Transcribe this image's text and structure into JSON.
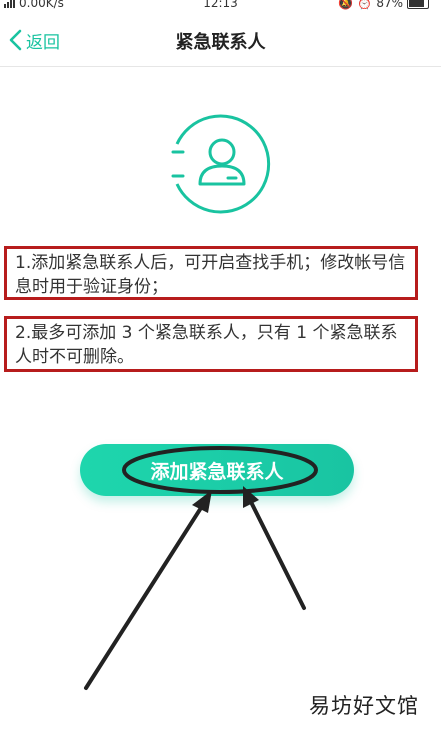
{
  "status_bar": {
    "network_speed": "0.00K/s",
    "time": "12:13",
    "battery_percent": "87%"
  },
  "header": {
    "back_label": "返回",
    "title": "紧急联系人"
  },
  "icons": {
    "back": "chevron-left-icon",
    "contact": "contact-person-icon"
  },
  "notes": [
    "1.添加紧急联系人后，可开启查找手机；修改帐号信息时用于验证身份；",
    "2.最多可添加 3 个紧急联系人，只有 1 个紧急联系人时不可删除。"
  ],
  "add_button": {
    "label": "添加紧急联系人"
  },
  "watermark": "易坊好文馆",
  "colors": {
    "accent": "#19c3a0",
    "highlight_box": "#b71c1c",
    "annotation": "#222222"
  }
}
